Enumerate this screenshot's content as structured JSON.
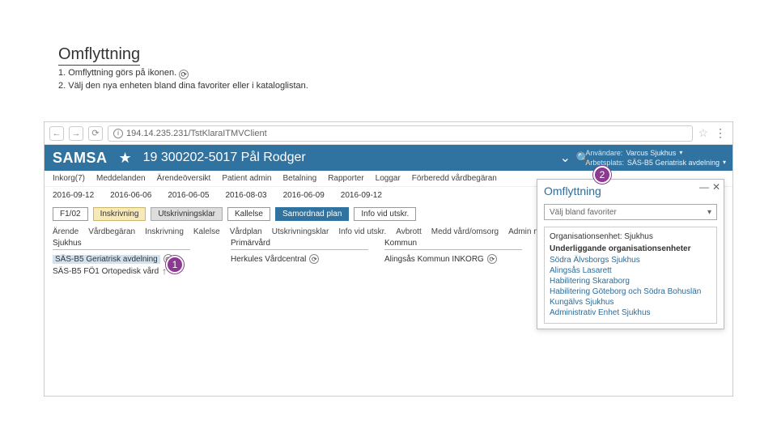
{
  "title": "Omflyttning",
  "bullet1_pre": "1. Omflyttning görs på ikonen.",
  "bullet2": "2. Välj den nya enheten bland dina favoriter eller i kataloglistan.",
  "address": "194.14.235.231/TstKlaraITMVClient",
  "app": {
    "logo": "SAMSA",
    "patient": "19 300202-5017 Pål Rodger"
  },
  "user": {
    "userLabel": "Användare:",
    "userValue": "Varcus Sjukhus",
    "workLabel": "Arbetsplats:",
    "workValue": "SÄS-B5 Geriatrisk avdelning"
  },
  "menu": [
    "Inkorg(7)",
    "Meddelanden",
    "Ärendeöversikt",
    "Patient admin",
    "Betalning",
    "Rapporter",
    "Loggar",
    "Förberedd vårdbegäran"
  ],
  "dates": [
    "2016-09-12",
    "2016-06-06",
    "2016-06-05",
    "2016-08-03",
    "2016-06-09",
    "2016-09-12"
  ],
  "tags": {
    "first": "F1/02",
    "items": [
      {
        "label": "Inskrivning",
        "cls": "filled-yellow"
      },
      {
        "label": "Utskrivningsklar",
        "cls": "filled-gray"
      },
      {
        "label": "Kallelse",
        "cls": ""
      },
      {
        "label": "Samordnad plan",
        "cls": "filled-blue"
      },
      {
        "label": "Info vid utskr.",
        "cls": ""
      }
    ]
  },
  "subtabs": [
    "Ärende",
    "Vårdbegäran",
    "Inskrivning",
    "Kalelse",
    "Vårdplan",
    "Utskrivningsklar",
    "Info vid utskr.",
    "Avbrott",
    "Medd vård/omsorg",
    "Admin medd."
  ],
  "cols": {
    "sjukhus": {
      "h": "Sjukhus",
      "a": "SÄS-B5 Geriatrisk avdelning",
      "b": "SÄS-B5 FÖ1 Ortopedisk vård"
    },
    "primar": {
      "h": "Primärvård",
      "a": "Herkules Vårdcentral"
    },
    "kommun": {
      "h": "Kommun",
      "a": "Alingsås Kommun INKORG"
    }
  },
  "panel": {
    "title": "Omflyttning",
    "select_placeholder": "Välj bland favoriter",
    "org_label": "Organisationsenhet: Sjukhus",
    "sub_label": "Underliggande organisationsenheter",
    "opts": [
      "Södra Älvsborgs Sjukhus",
      "Alingsås Lasarett",
      "Habilitering Skaraborg",
      "Habilitering Göteborg och Södra Bohuslän",
      "Kungälvs Sjukhus",
      "Administrativ Enhet Sjukhus"
    ]
  },
  "callouts": {
    "one": "1",
    "two": "2"
  }
}
